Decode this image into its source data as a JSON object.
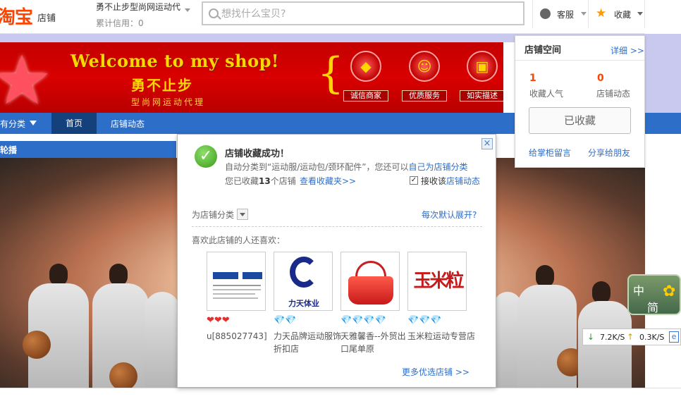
{
  "header": {
    "logo_text": "淘宝",
    "logo_sub": "店铺",
    "shop_name": "勇不止步型尚网运动代",
    "credit": "累计信用：0",
    "search_placeholder": "想找什么宝贝?",
    "service_label": "客服",
    "favorite_label": "收藏"
  },
  "banner": {
    "welcome": "Welcome to my shop!",
    "slogan": "勇不止步",
    "sub": "型尚网运动代理",
    "badges": [
      "诚信商家",
      "优质服务",
      "如实描述"
    ]
  },
  "nav": {
    "categories": "有分类",
    "home": "首页",
    "dynamics": "店铺动态"
  },
  "carousel": {
    "title": "轮播"
  },
  "shop_space": {
    "title": "店铺空间",
    "detail": "详细 >>",
    "popularity_count": "1",
    "popularity_label": "收藏人气",
    "dynamics_count": "0",
    "dynamics_label": "店铺动态",
    "favorited_button": "已收藏",
    "leave_message": "给掌柜留言",
    "share": "分享给朋友"
  },
  "dialog": {
    "close": "×",
    "title": "店铺收藏成功！",
    "line1_prefix": "自动分类到“运动服/运动包/颈环配件”，您还可以",
    "line1_link": "自己为店铺分类",
    "line2_prefix": "您已收藏",
    "line2_count": "13",
    "line2_suffix": "个店铺",
    "fav_folder": "查看收藏夹>>",
    "receive_prefix": "接收该",
    "receive_link": "店铺动态",
    "category_label": "为店铺分类",
    "expand_link": "每次默认展开?",
    "also_like": "喜欢此店铺的人还喜欢：",
    "more_link": "更多优选店铺 >>",
    "products": [
      {
        "rank": "❤❤❤",
        "name": "u[885027743]",
        "rank_color": "red"
      },
      {
        "rank": "💎💎",
        "name": "力天品牌运动服饰折扣店",
        "rank_color": "blue"
      },
      {
        "rank": "💎💎💎💎",
        "name": "天雅馨香--外贸出口尾单原",
        "rank_color": "blue"
      },
      {
        "rank": "💎💎💎",
        "name": "玉米粒运动专营店",
        "rank_color": "blue"
      }
    ],
    "product_images": [
      "mizuno-icon",
      "liutian-logo-icon",
      "red-handbag-icon",
      "yumili-logo-icon"
    ],
    "liutian_logo_text": "力天体业",
    "yumili_logo_text": "玉米粒"
  },
  "widgets": {
    "ime_zh": "中",
    "ime_jian": "简",
    "down_speed": "7.2K/S",
    "up_speed": "0.3K/S"
  },
  "colors": {
    "nav_blue": "#2d6ec8",
    "banner_red": "#c40000",
    "accent_orange": "#ff4400",
    "link_blue": "#2d6ec8"
  }
}
